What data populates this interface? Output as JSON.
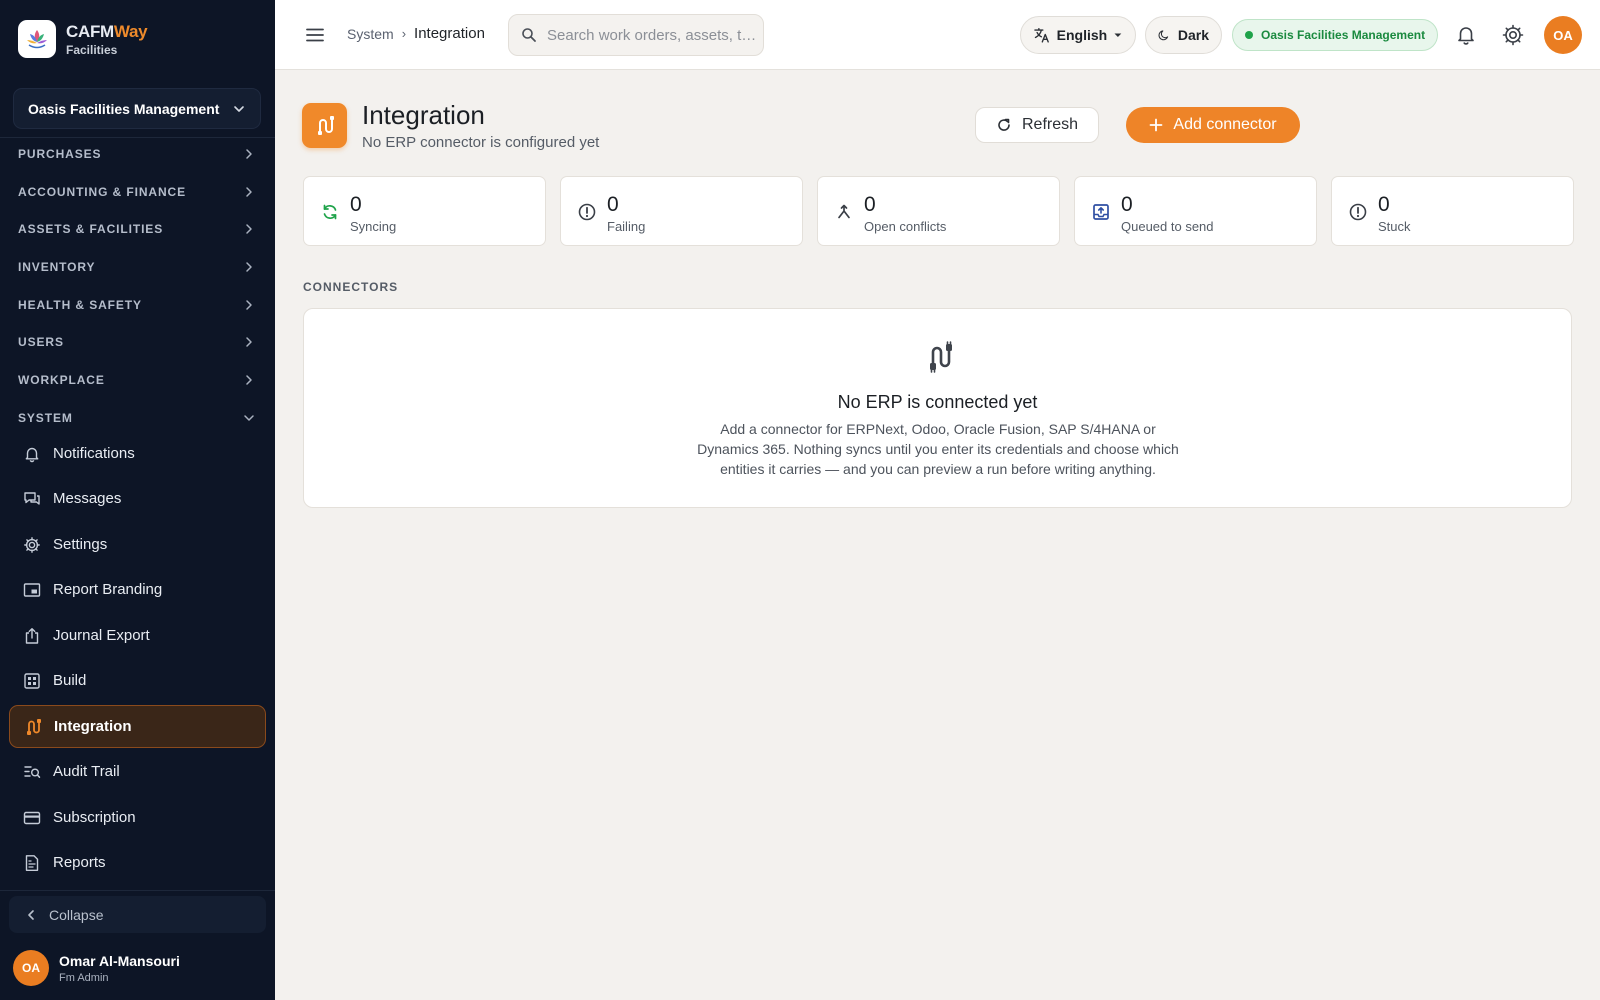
{
  "brand": {
    "name_part1": "CAFM",
    "name_part2": "Way",
    "subtitle": "Facilities"
  },
  "sidebar": {
    "org_selector": "Oasis Facilities Management",
    "sections": [
      {
        "label": "PURCHASES",
        "expanded": false
      },
      {
        "label": "ACCOUNTING & FINANCE",
        "expanded": false
      },
      {
        "label": "ASSETS & FACILITIES",
        "expanded": false
      },
      {
        "label": "INVENTORY",
        "expanded": false
      },
      {
        "label": "HEALTH & SAFETY",
        "expanded": false
      },
      {
        "label": "USERS",
        "expanded": false
      },
      {
        "label": "WORKPLACE",
        "expanded": false
      },
      {
        "label": "SYSTEM",
        "expanded": true
      }
    ],
    "items": [
      {
        "label": "Notifications",
        "icon": "bell-icon"
      },
      {
        "label": "Messages",
        "icon": "chat-icon"
      },
      {
        "label": "Settings",
        "icon": "gear-icon"
      },
      {
        "label": "Report Branding",
        "icon": "branding-icon"
      },
      {
        "label": "Journal Export",
        "icon": "export-icon"
      },
      {
        "label": "Build",
        "icon": "build-icon"
      },
      {
        "label": "Integration",
        "icon": "integration-icon",
        "active": true
      },
      {
        "label": "Audit Trail",
        "icon": "audit-icon"
      },
      {
        "label": "Subscription",
        "icon": "card-icon"
      },
      {
        "label": "Reports",
        "icon": "report-icon"
      }
    ],
    "collapse_label": "Collapse",
    "user": {
      "initials": "OA",
      "name": "Omar Al-Mansouri",
      "role": "Fm Admin"
    }
  },
  "topbar": {
    "breadcrumb": [
      "System",
      "Integration"
    ],
    "search_placeholder": "Search work orders, assets, t…",
    "language": "English",
    "theme": "Dark",
    "org_badge": "Oasis Facilities Management",
    "avatar_initials": "OA"
  },
  "page": {
    "title": "Integration",
    "subtitle": "No ERP connector is configured yet",
    "refresh_label": "Refresh",
    "add_label": "Add connector"
  },
  "stats": [
    {
      "value": "0",
      "label": "Syncing",
      "icon": "sync-icon",
      "color": "#1fa34a"
    },
    {
      "value": "0",
      "label": "Failing",
      "icon": "alert-circle-icon",
      "color": "#3a3f47"
    },
    {
      "value": "0",
      "label": "Open conflicts",
      "icon": "merge-icon",
      "color": "#3a3f47"
    },
    {
      "value": "0",
      "label": "Queued to send",
      "icon": "outbox-icon",
      "color": "#2f4fa3"
    },
    {
      "value": "0",
      "label": "Stuck",
      "icon": "alert-circle-icon",
      "color": "#3a3f47"
    }
  ],
  "connectors": {
    "section_label": "CONNECTORS",
    "empty_title": "No ERP is connected yet",
    "empty_description": "Add a connector for ERPNext, Odoo, Oracle Fusion, SAP S/4HANA or Dynamics 365. Nothing syncs until you enter its credentials and choose which entities it carries — and you can preview a run before writing anything."
  },
  "colors": {
    "accent": "#ee8428",
    "sidebar_bg": "#0d1526",
    "page_bg": "#f3f1ee",
    "success": "#1fa34a"
  }
}
